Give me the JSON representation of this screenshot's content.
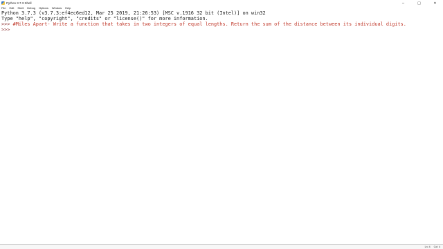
{
  "window": {
    "title": "Python 3.7.3 Shell",
    "controls": {
      "minimize": "─",
      "maximize": "□",
      "close": "✕"
    }
  },
  "menu": [
    "File",
    "Edit",
    "Shell",
    "Debug",
    "Options",
    "Window",
    "Help"
  ],
  "shell": {
    "banner_line1": "Python 3.7.3 (v3.7.3:ef4ec6ed12, Mar 25 2019, 21:26:53) [MSC v.1916 32 bit (Intel)] on win32",
    "banner_line2": "Type \"help\", \"copyright\", \"credits\" or \"license()\" for more information.",
    "prompt": ">>> ",
    "comment_line": "#Miles Apart- Write a function that takes in two integers of equal lengths. Return the sum of the distance between its individual digits.",
    "empty_prompt": ">>>"
  },
  "status": {
    "line": "Ln: 4",
    "col": "Col: 4"
  },
  "colors": {
    "comment": "#c0392b",
    "prompt": "#8b2d2d",
    "output": "#1a1a1a"
  }
}
